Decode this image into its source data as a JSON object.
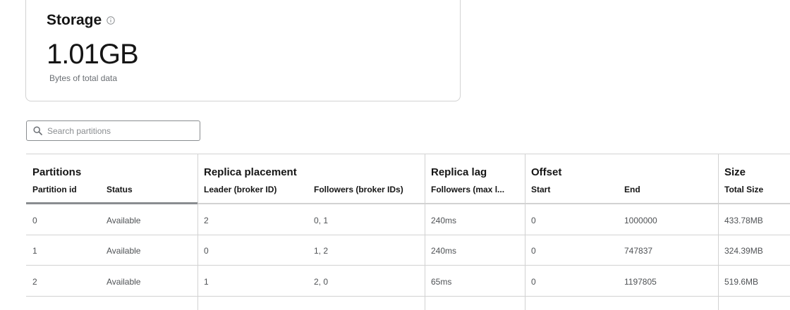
{
  "storage": {
    "title": "Storage",
    "value": "1.01GB",
    "caption": "Bytes of total data"
  },
  "search": {
    "placeholder": "Search partitions"
  },
  "table": {
    "groups": {
      "partitions": "Partitions",
      "replica_placement": "Replica placement",
      "replica_lag": "Replica lag",
      "offset": "Offset",
      "size": "Size"
    },
    "columns": {
      "partition_id": "Partition id",
      "status": "Status",
      "leader": "Leader (broker ID)",
      "followers": "Followers (broker IDs)",
      "lag": "Followers (max l...",
      "start": "Start",
      "end": "End",
      "total_size": "Total Size"
    },
    "rows": [
      {
        "partition_id": "0",
        "status": "Available",
        "leader": "2",
        "followers": "0, 1",
        "lag": "240ms",
        "start": "0",
        "end": "1000000",
        "total_size": "433.78MB"
      },
      {
        "partition_id": "1",
        "status": "Available",
        "leader": "0",
        "followers": "1, 2",
        "lag": "240ms",
        "start": "0",
        "end": "747837",
        "total_size": "324.39MB"
      },
      {
        "partition_id": "2",
        "status": "Available",
        "leader": "1",
        "followers": "2, 0",
        "lag": "65ms",
        "start": "0",
        "end": "1197805",
        "total_size": "519.6MB"
      }
    ]
  },
  "icons": {
    "info": "info-circle-icon",
    "search": "search-icon"
  }
}
